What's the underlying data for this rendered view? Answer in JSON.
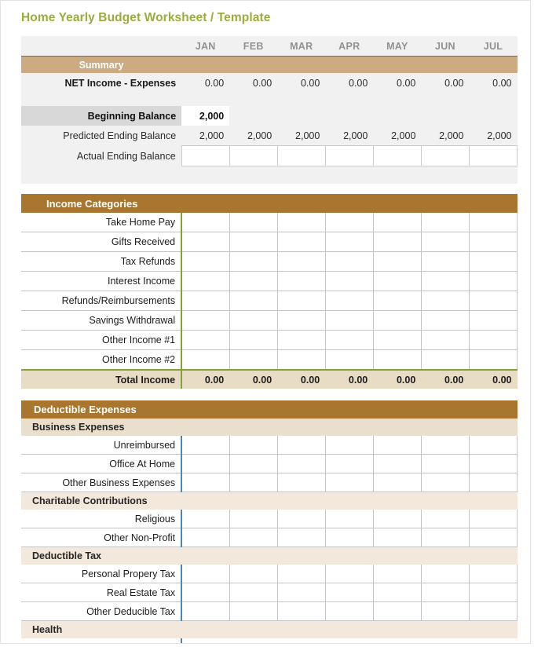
{
  "page": {
    "title": "Home Yearly Budget Worksheet / Template",
    "title_color": "#9aad3c"
  },
  "colors": {
    "summary_bar": "#ccab82",
    "section_bar": "#a9762f",
    "income_divider": "#84a038",
    "deduct_divider": "#4e86ae",
    "total_row_bg": "#e8dcc4",
    "subsection_bg": "#f2e8dc",
    "begin_label_bg": "#d8d8d8",
    "summary_bg": "#f1f1f1"
  },
  "months": [
    "JAN",
    "FEB",
    "MAR",
    "APR",
    "MAY",
    "JUN",
    "JUL"
  ],
  "summary": {
    "bar_label": "Summary",
    "net_income": {
      "label": "NET Income - Expenses",
      "values": [
        "0.00",
        "0.00",
        "0.00",
        "0.00",
        "0.00",
        "0.00",
        "0.00"
      ]
    },
    "beginning_balance": {
      "label": "Beginning Balance",
      "values": [
        "2,000",
        "",
        "",
        "",
        "",
        "",
        ""
      ]
    },
    "predicted_ending_balance": {
      "label": "Predicted Ending Balance",
      "values": [
        "2,000",
        "2,000",
        "2,000",
        "2,000",
        "2,000",
        "2,000",
        "2,000"
      ]
    },
    "actual_ending_balance": {
      "label": "Actual Ending Balance",
      "values": [
        "",
        "",
        "",
        "",
        "",
        "",
        ""
      ]
    }
  },
  "income": {
    "bar_label": "Income Categories",
    "rows": [
      {
        "label": "Take Home Pay",
        "values": [
          "",
          "",
          "",
          "",
          "",
          "",
          ""
        ]
      },
      {
        "label": "Gifts Received",
        "values": [
          "",
          "",
          "",
          "",
          "",
          "",
          ""
        ]
      },
      {
        "label": "Tax Refunds",
        "values": [
          "",
          "",
          "",
          "",
          "",
          "",
          ""
        ]
      },
      {
        "label": "Interest Income",
        "values": [
          "",
          "",
          "",
          "",
          "",
          "",
          ""
        ]
      },
      {
        "label": "Refunds/Reimbursements",
        "values": [
          "",
          "",
          "",
          "",
          "",
          "",
          ""
        ]
      },
      {
        "label": "Savings Withdrawal",
        "values": [
          "",
          "",
          "",
          "",
          "",
          "",
          ""
        ]
      },
      {
        "label": "Other Income #1",
        "values": [
          "",
          "",
          "",
          "",
          "",
          "",
          ""
        ]
      },
      {
        "label": "Other Income #2",
        "values": [
          "",
          "",
          "",
          "",
          "",
          "",
          ""
        ]
      }
    ],
    "total": {
      "label": "Total Income",
      "values": [
        "0.00",
        "0.00",
        "0.00",
        "0.00",
        "0.00",
        "0.00",
        "0.00"
      ]
    }
  },
  "deductible": {
    "bar_label": "Deductible Expenses",
    "groups": [
      {
        "label": "Business Expenses",
        "rows": [
          {
            "label": "Unreimbursed",
            "values": [
              "",
              "",
              "",
              "",
              "",
              "",
              ""
            ]
          },
          {
            "label": "Office At Home",
            "values": [
              "",
              "",
              "",
              "",
              "",
              "",
              ""
            ]
          },
          {
            "label": "Other Business Expenses",
            "values": [
              "",
              "",
              "",
              "",
              "",
              "",
              ""
            ]
          }
        ]
      },
      {
        "label": "Charitable Contributions",
        "rows": [
          {
            "label": "Religious",
            "values": [
              "",
              "",
              "",
              "",
              "",
              "",
              ""
            ]
          },
          {
            "label": "Other Non-Profit",
            "values": [
              "",
              "",
              "",
              "",
              "",
              "",
              ""
            ]
          }
        ]
      },
      {
        "label": "Deductible Tax",
        "rows": [
          {
            "label": "Personal Propery Tax",
            "values": [
              "",
              "",
              "",
              "",
              "",
              "",
              ""
            ]
          },
          {
            "label": "Real Estate Tax",
            "values": [
              "",
              "",
              "",
              "",
              "",
              "",
              ""
            ]
          },
          {
            "label": "Other Deducible Tax",
            "values": [
              "",
              "",
              "",
              "",
              "",
              "",
              ""
            ]
          }
        ]
      },
      {
        "label": "Health",
        "rows": []
      }
    ]
  }
}
